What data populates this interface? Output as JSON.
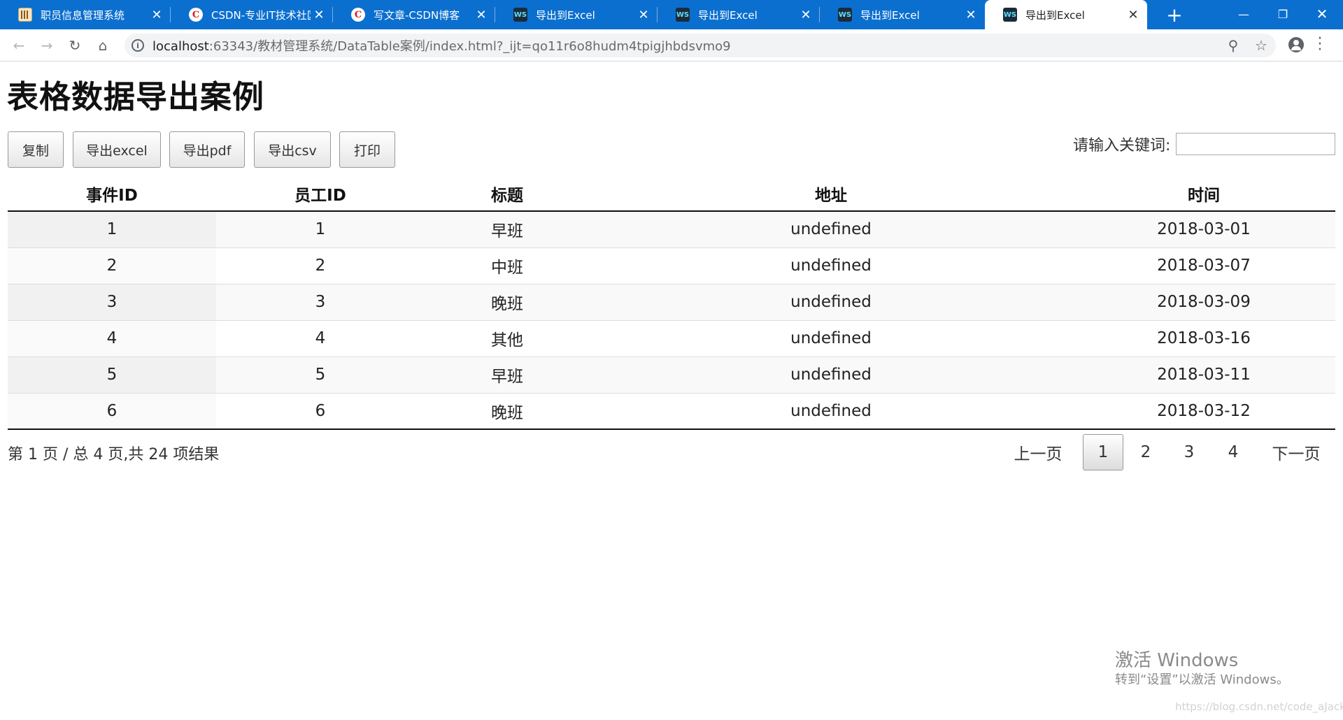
{
  "browser": {
    "tabs": [
      {
        "title": "职员信息管理系统",
        "icon": "grid-icon",
        "active": false
      },
      {
        "title": "CSDN-专业IT技术社区",
        "icon": "csdn-icon",
        "active": false
      },
      {
        "title": "写文章-CSDN博客",
        "icon": "csdn-icon",
        "active": false
      },
      {
        "title": "导出到Excel",
        "icon": "webstorm-icon",
        "active": false
      },
      {
        "title": "导出到Excel",
        "icon": "webstorm-icon",
        "active": false
      },
      {
        "title": "导出到Excel",
        "icon": "webstorm-icon",
        "active": false
      },
      {
        "title": "导出到Excel",
        "icon": "webstorm-icon",
        "active": true
      }
    ],
    "url_host": "localhost",
    "url_path": ":63343/教材管理系统/DataTable案例/index.html?_ijt=qo11r6o8hudm4tpigjhbdsvmo9",
    "tab_accent": "#0b6fcf"
  },
  "page": {
    "title": "表格数据导出案例",
    "buttons": [
      "复制",
      "导出excel",
      "导出pdf",
      "导出csv",
      "打印"
    ],
    "search_label": "请输入关键词:",
    "search_value": ""
  },
  "table": {
    "columns": [
      "事件ID",
      "员工ID",
      "标题",
      "地址",
      "时间"
    ],
    "rows": [
      [
        "1",
        "1",
        "早班",
        "undefined",
        "2018-03-01"
      ],
      [
        "2",
        "2",
        "中班",
        "undefined",
        "2018-03-07"
      ],
      [
        "3",
        "3",
        "晚班",
        "undefined",
        "2018-03-09"
      ],
      [
        "4",
        "4",
        "其他",
        "undefined",
        "2018-03-16"
      ],
      [
        "5",
        "5",
        "早班",
        "undefined",
        "2018-03-11"
      ],
      [
        "6",
        "6",
        "晚班",
        "undefined",
        "2018-03-12"
      ]
    ]
  },
  "pagination": {
    "info": "第 1 页 / 总 4 页,共 24 项结果",
    "previous": "上一页",
    "pages": [
      "1",
      "2",
      "3",
      "4"
    ],
    "current_page": "1",
    "next": "下一页"
  },
  "watermark": {
    "title": "激活 Windows",
    "subtitle": "转到“设置”以激活 Windows。",
    "blog": "https://blog.csdn.net/code_aJack"
  }
}
